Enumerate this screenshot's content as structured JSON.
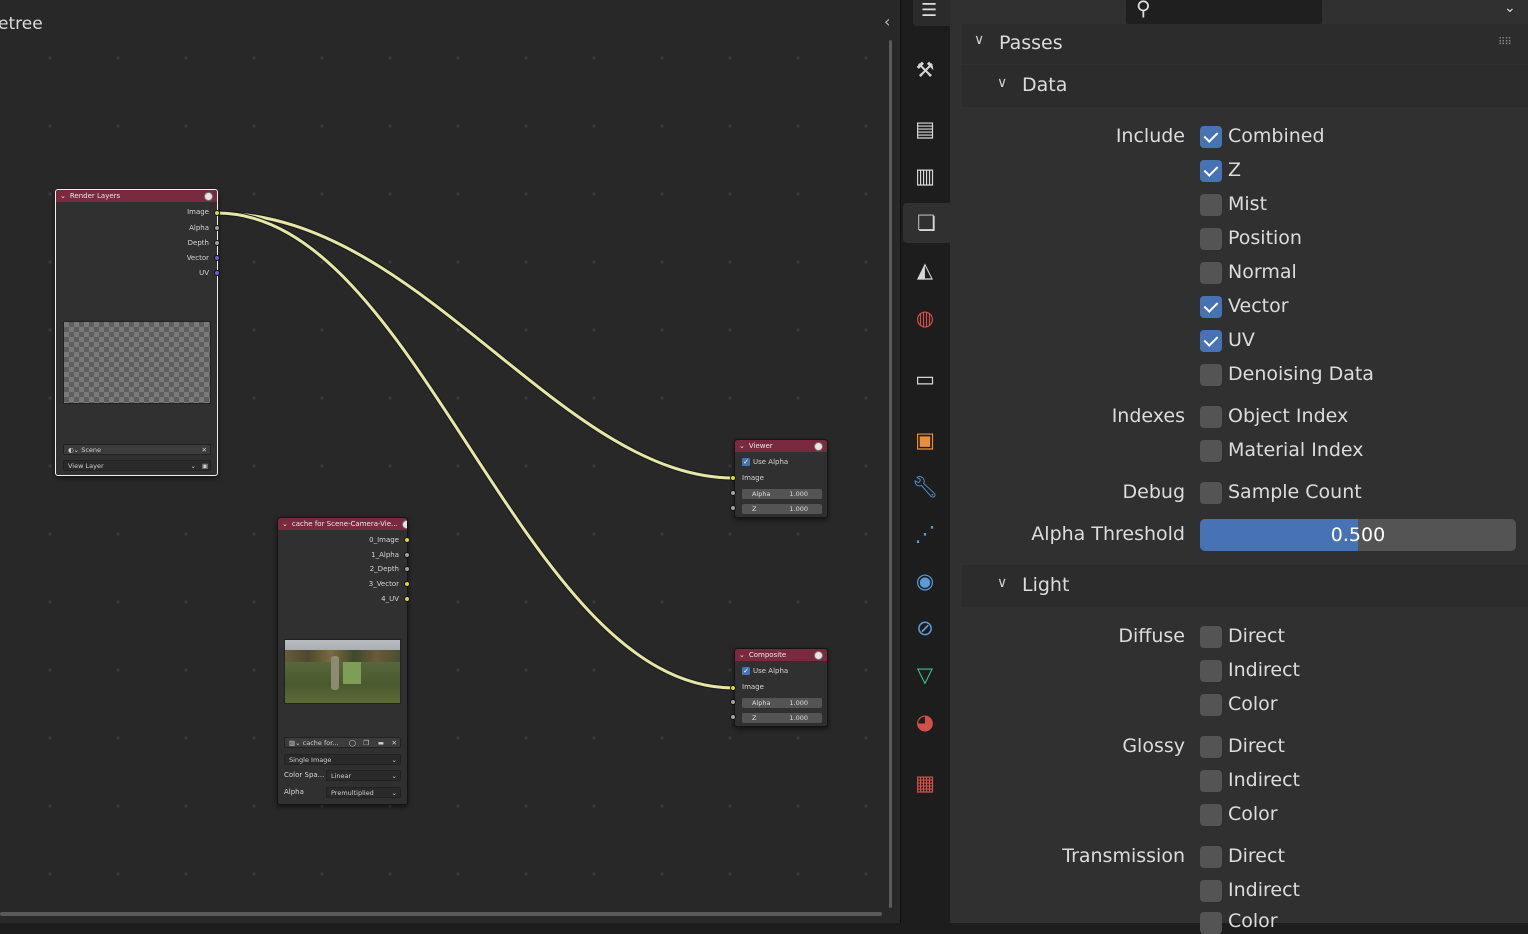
{
  "editor": {
    "title": "etree",
    "nodes": {
      "render_layers": {
        "title": "Render Layers",
        "outputs": [
          "Image",
          "Alpha",
          "Depth",
          "Vector",
          "UV"
        ],
        "scene": "Scene",
        "view_layer": "View Layer"
      },
      "cache": {
        "title": "cache for Scene-Camera-Vie...",
        "outputs": [
          "0_Image",
          "1_Alpha",
          "2_Depth",
          "3_Vector",
          "4_UV"
        ],
        "image_name": "cache for...",
        "source": "Single Image",
        "color_space_label": "Color Spa...",
        "color_space": "Linear",
        "alpha_label": "Alpha",
        "alpha": "Premultiplied"
      },
      "viewer": {
        "title": "Viewer",
        "use_alpha": "Use Alpha",
        "image": "Image",
        "alpha_label": "Alpha",
        "alpha": "1.000",
        "z_label": "Z",
        "z": "1.000"
      },
      "composite": {
        "title": "Composite",
        "use_alpha": "Use Alpha",
        "image": "Image",
        "alpha_label": "Alpha",
        "alpha": "1.000",
        "z_label": "Z",
        "z": "1.000"
      }
    }
  },
  "tabs": [
    "tool",
    "render",
    "output",
    "view-layer",
    "scene",
    "world",
    "collection",
    "object",
    "modifier",
    "particles",
    "physics",
    "constraints",
    "data",
    "material",
    "texture"
  ],
  "props": {
    "passes": "Passes",
    "data": {
      "title": "Data",
      "include_label": "Include",
      "include": [
        {
          "label": "Combined",
          "checked": true
        },
        {
          "label": "Z",
          "checked": true
        },
        {
          "label": "Mist",
          "checked": false
        },
        {
          "label": "Position",
          "checked": false
        },
        {
          "label": "Normal",
          "checked": false
        },
        {
          "label": "Vector",
          "checked": true
        },
        {
          "label": "UV",
          "checked": true
        },
        {
          "label": "Denoising Data",
          "checked": false
        }
      ],
      "indexes_label": "Indexes",
      "indexes": [
        {
          "label": "Object Index",
          "checked": false
        },
        {
          "label": "Material Index",
          "checked": false
        }
      ],
      "debug_label": "Debug",
      "debug": [
        {
          "label": "Sample Count",
          "checked": false
        }
      ],
      "alpha_threshold_label": "Alpha Threshold",
      "alpha_threshold": "0.500"
    },
    "light": {
      "title": "Light",
      "diffuse_label": "Diffuse",
      "diffuse": [
        "Direct",
        "Indirect",
        "Color"
      ],
      "glossy_label": "Glossy",
      "glossy": [
        "Direct",
        "Indirect",
        "Color"
      ],
      "transmission_label": "Transmission",
      "transmission": [
        "Direct",
        "Indirect",
        "Color"
      ]
    }
  },
  "colors": {
    "accent": "#4772b3",
    "node_header": "#7a2a3f",
    "link": "#e6e6a8"
  }
}
